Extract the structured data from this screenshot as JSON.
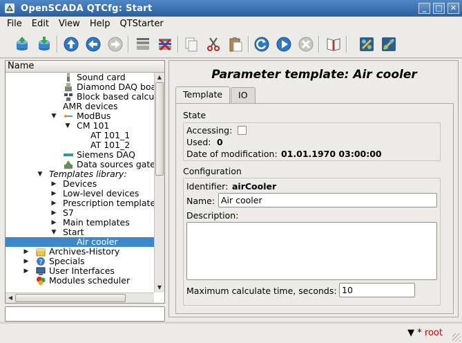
{
  "window": {
    "title": "OpenSCADA QTCfg: Start",
    "buttons": {
      "minimize": "_",
      "maximize": "□",
      "close": "✕"
    }
  },
  "menu": [
    {
      "label": "File"
    },
    {
      "label": "Edit"
    },
    {
      "label": "View"
    },
    {
      "label": "Help"
    },
    {
      "label": "QTStarter"
    }
  ],
  "toolbar": {
    "icons": [
      "db-load-icon",
      "db-save-icon",
      "up-icon",
      "back-icon",
      "forward-icon",
      "add-item-icon",
      "delete-item-icon",
      "copy-icon",
      "cut-icon",
      "paste-icon",
      "refresh-icon",
      "start-icon",
      "stop-icon",
      "manual-icon",
      "module-info-icon",
      "module-settings-icon"
    ]
  },
  "tree": {
    "header": "Name",
    "items": [
      {
        "label": "Sound card",
        "indent": 5,
        "icon": "sound-card-icon"
      },
      {
        "label": "Diamond DAQ boa",
        "indent": 5,
        "icon": "diamond-daq-icon"
      },
      {
        "label": "Block based calcu",
        "indent": 5,
        "icon": "block-calc-icon"
      },
      {
        "label": "AMR devices",
        "indent": 5,
        "icon": ""
      },
      {
        "label": "ModBus",
        "indent": 5,
        "icon": "modbus-icon",
        "expanded": true
      },
      {
        "label": "CM 101",
        "indent": 6,
        "icon": "",
        "expanded": true
      },
      {
        "label": "AT 101_1",
        "indent": 8,
        "icon": ""
      },
      {
        "label": "AT 101_2",
        "indent": 8,
        "icon": ""
      },
      {
        "label": "Siemens DAQ",
        "indent": 5,
        "icon": "siemens-icon"
      },
      {
        "label": "Data sources gate",
        "indent": 5,
        "icon": "data-gate-icon"
      },
      {
        "label": "Templates library:",
        "indent": 3,
        "icon": "",
        "expanded": true,
        "italic": true
      },
      {
        "label": "Devices",
        "indent": 4,
        "icon": "",
        "collapsed": true
      },
      {
        "label": "Low-level devices",
        "indent": 4,
        "icon": "",
        "collapsed": true
      },
      {
        "label": "Prescription template",
        "indent": 4,
        "icon": "",
        "collapsed": true
      },
      {
        "label": "S7",
        "indent": 4,
        "icon": "",
        "collapsed": true
      },
      {
        "label": "Main templates",
        "indent": 4,
        "icon": "",
        "collapsed": true
      },
      {
        "label": "Start",
        "indent": 4,
        "icon": "",
        "expanded": true
      },
      {
        "label": "Air cooler",
        "indent": 6,
        "icon": "",
        "selected": true
      },
      {
        "label": "Archives-History",
        "indent": 2,
        "icon": "archive-icon",
        "collapsed": true
      },
      {
        "label": "Specials",
        "indent": 2,
        "icon": "specials-icon",
        "collapsed": true
      },
      {
        "label": "User Interfaces",
        "indent": 2,
        "icon": "ui-icon",
        "collapsed": true
      },
      {
        "label": "Modules scheduler",
        "indent": 2,
        "icon": "scheduler-icon"
      }
    ]
  },
  "panel": {
    "title": "Parameter template: Air cooler",
    "tabs": [
      {
        "label": "Template",
        "active": true
      },
      {
        "label": "IO",
        "active": false
      }
    ],
    "state": {
      "group_title": "State",
      "accessing_label": "Accessing:",
      "accessing_checked": false,
      "used_label": "Used:",
      "used_value": "0",
      "date_label": "Date of modification:",
      "date_value": "01.01.1970 03:00:00"
    },
    "config": {
      "group_title": "Configuration",
      "identifier_label": "Identifier:",
      "identifier_value": "airCooler",
      "name_label": "Name:",
      "name_value": "Air cooler",
      "description_label": "Description:",
      "description_value": "",
      "max_time_label": "Maximum calculate time, seconds:",
      "max_time_value": "10"
    }
  },
  "status": {
    "indicator": "▼ *",
    "user": "root"
  }
}
